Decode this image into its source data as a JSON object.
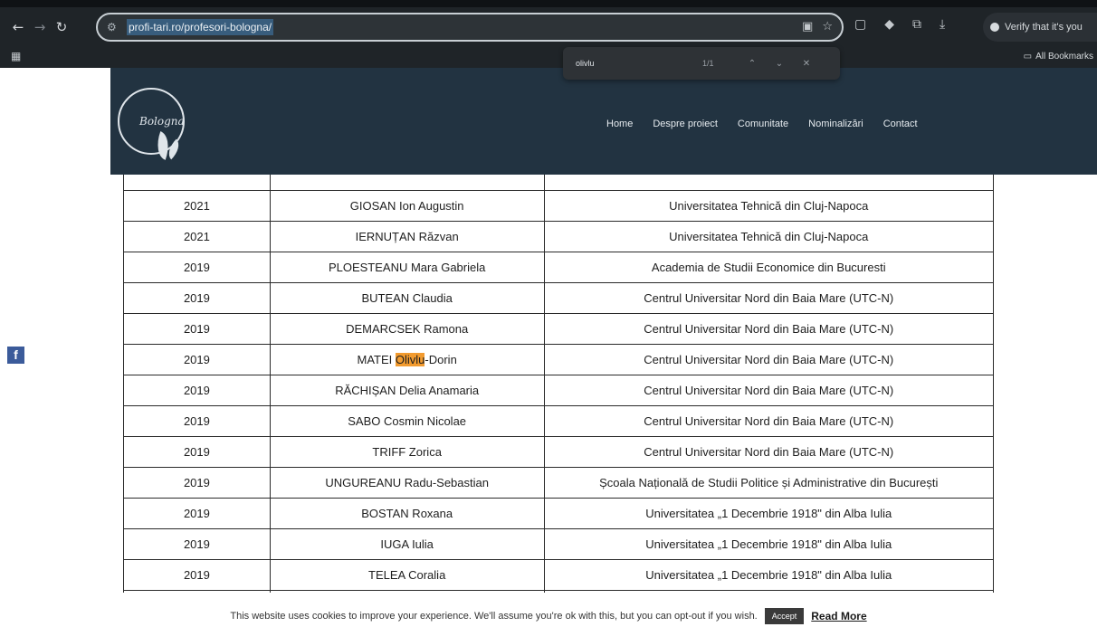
{
  "browser": {
    "url": "profi-tari.ro/profesori-bologna/",
    "profile_label": "Verify that it's you",
    "all_bookmarks_label": "All Bookmarks",
    "find": {
      "query": "olivlu",
      "count": "1/1"
    }
  },
  "site": {
    "logo_text": "Bologna",
    "nav": [
      "Home",
      "Despre proiect",
      "Comunitate",
      "Nominalizări",
      "Contact"
    ]
  },
  "table": {
    "rows": [
      {
        "year": "2021",
        "name": "GIOSAN Ion Augustin",
        "university": "Universitatea Tehnică din Cluj-Napoca"
      },
      {
        "year": "2021",
        "name": "IERNUȚAN Răzvan",
        "university": "Universitatea Tehnică din Cluj-Napoca"
      },
      {
        "year": "2019",
        "name": "PLOESTEANU Mara Gabriela",
        "university": "Academia de Studii Economice din Bucuresti"
      },
      {
        "year": "2019",
        "name": "BUTEAN Claudia",
        "university": "Centrul Universitar Nord din Baia Mare (UTC-N)"
      },
      {
        "year": "2019",
        "name": "DEMARCSEK Ramona",
        "university": "Centrul Universitar Nord din Baia Mare (UTC-N)"
      },
      {
        "year": "2019",
        "name_pre": "MATEI ",
        "name_hl": "Olivlu",
        "name_post": "-Dorin",
        "university": "Centrul Universitar Nord din Baia Mare (UTC-N)"
      },
      {
        "year": "2019",
        "name": "RĂCHIȘAN Delia Anamaria",
        "university": "Centrul Universitar Nord din Baia Mare (UTC-N)"
      },
      {
        "year": "2019",
        "name": "SABO Cosmin Nicolae",
        "university": "Centrul Universitar Nord din Baia Mare (UTC-N)"
      },
      {
        "year": "2019",
        "name": "TRIFF Zorica",
        "university": "Centrul Universitar Nord din Baia Mare (UTC-N)"
      },
      {
        "year": "2019",
        "name": "UNGUREANU Radu-Sebastian",
        "university": "Școala Națională de Studii Politice și Administrative din București"
      },
      {
        "year": "2019",
        "name": "BOSTAN Roxana",
        "university": "Universitatea „1 Decembrie 1918\" din Alba Iulia"
      },
      {
        "year": "2019",
        "name": "IUGA Iulia",
        "university": "Universitatea „1 Decembrie 1918\" din Alba Iulia"
      },
      {
        "year": "2019",
        "name": "TELEA Coralia",
        "university": "Universitatea „1 Decembrie 1918\" din Alba Iulia"
      }
    ]
  },
  "cookie": {
    "text": "This website uses cookies to improve your experience. We'll assume you're ok with this, but you can opt-out if you wish.",
    "accept": "Accept",
    "read_more": "Read More"
  },
  "colors": {
    "header_bg": "#223341",
    "highlight": "#f29b2f",
    "facebook": "#3b5b9a"
  }
}
